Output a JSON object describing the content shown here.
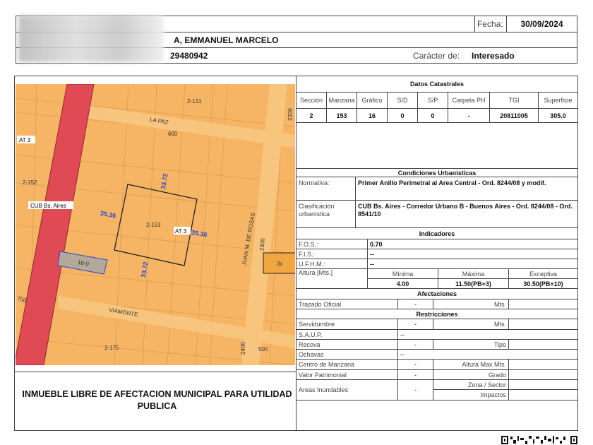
{
  "header": {
    "fecha_label": "Fecha:",
    "fecha_value": "30/09/2024",
    "name_visible": "A, EMMANUEL MARCELO",
    "doc_number": "29480942",
    "caracter_label": "Carácter de:",
    "caracter_value": "Interesado"
  },
  "map": {
    "labels": {
      "block_north": "2-131",
      "street_north": "LA PAZ",
      "num_600": "600",
      "num_2200": "2200",
      "zone_left": "AT 3",
      "block_west": "2-152",
      "corridor": "CUB Bs. Aires",
      "dim_left": "35.36",
      "dim_top": "33.72",
      "block_main": "2-153",
      "zone_right": "AT 3",
      "dim_right": "35.36",
      "parcel": "16-0",
      "dim_bottom": "33.72",
      "street_east": "JUAN M. DE ROSAS",
      "num_2300": "2300",
      "parcel_east": "3c",
      "num_700": "700",
      "street_south": "VIAMONTE",
      "block_south": "2-175",
      "num_2400": "2400",
      "num_500": "500"
    },
    "colors": {
      "zone": "#f5b565",
      "corridor": "#e04a55",
      "street": "#f8c57f",
      "dims": "#3344cc"
    }
  },
  "notice": "INMUEBLE LIBRE DE AFECTACION MUNICIPAL PARA UTILIDAD PUBLICA",
  "catastro": {
    "title": "Datos Catastrales",
    "headers": [
      "Sección",
      "Manzana",
      "Gráfico",
      "S/D",
      "S/P",
      "Carpeta PH",
      "TGI",
      "Superficie"
    ],
    "values": [
      "2",
      "153",
      "16",
      "0",
      "0",
      "-",
      "20811005",
      "305.0"
    ]
  },
  "condiciones": {
    "title": "Condiciones Urbanisticas",
    "normativa_label": "Normativa:",
    "normativa_value": "Primer Anillo Perimetral al Area Central - Ord. 8244/08 y modif.",
    "clasificacion_label": "Clasificación urbanística",
    "clasificacion_value": "CUB Bs. Aires - Corredor Urbano B - Buenos Aires - Ord. 8244/08 - Ord. 8541/10"
  },
  "indicadores": {
    "title": "Indicadores",
    "fos_label": "F.O.S.:",
    "fos_value": "0.70",
    "fis_label": "F.I.S.:",
    "fis_value": "--",
    "ufhm_label": "U.F.H.M.:",
    "ufhm_value": "--",
    "altura_label": "Altura [Mts.]",
    "altura_headers": [
      "Mínima",
      "Máxima",
      "Exceptiva"
    ],
    "altura_values": [
      "4.00",
      "11.50(PB+3)",
      "30.50(PB+10)"
    ]
  },
  "afectaciones": {
    "title": "Afectaciones",
    "trazado_label": "Trazado Oficial",
    "trazado_value": "-",
    "trazado_unit": "Mts."
  },
  "restricciones": {
    "title": "Restricciones",
    "servidumbre_label": "Servidumbre",
    "servidumbre_value": "-",
    "servidumbre_unit": "Mts.",
    "saup_label": "S.A.U.P.",
    "saup_value": "--",
    "recova_label": "Recova",
    "recova_value": "-",
    "recova_unit": "Tipo",
    "ochavas_label": "Ochavas",
    "ochavas_value": "--",
    "centro_label": "Centro de Manzana",
    "centro_value": "-",
    "centro_unit": "Altura Max Mts.",
    "valor_label": "Valor Patrimonial",
    "valor_value": "-",
    "valor_unit": "Grado",
    "areas_label": "Areas Inundables",
    "areas_value": "-",
    "areas_unit1": "Zona / Sector",
    "areas_unit2": "Impactos"
  }
}
